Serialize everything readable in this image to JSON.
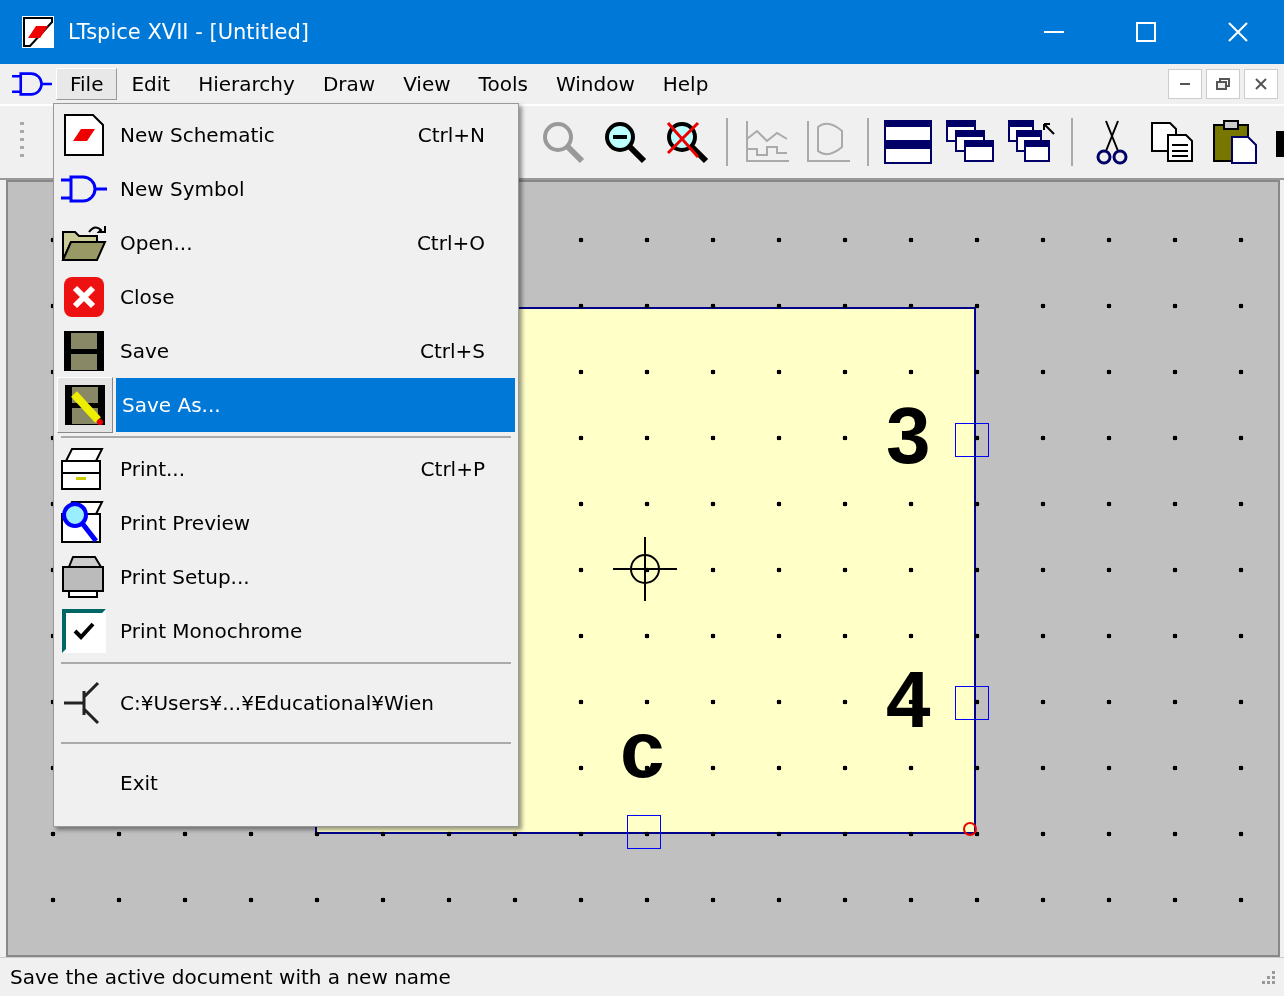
{
  "window": {
    "title": "LTspice XVII - [Untitled]"
  },
  "menu_bar": [
    {
      "label": "File",
      "selected": true
    },
    {
      "label": "Edit",
      "selected": false
    },
    {
      "label": "Hierarchy",
      "selected": false
    },
    {
      "label": "Draw",
      "selected": false
    },
    {
      "label": "View",
      "selected": false
    },
    {
      "label": "Tools",
      "selected": false
    },
    {
      "label": "Window",
      "selected": false
    },
    {
      "label": "Help",
      "selected": false
    }
  ],
  "file_menu": {
    "groups": [
      [
        {
          "kind": "command",
          "label": "New Schematic",
          "shortcut": "Ctrl+N",
          "selected": false
        },
        {
          "kind": "command",
          "label": "New Symbol",
          "selected": false
        },
        {
          "kind": "command",
          "label": "Open...",
          "shortcut": "Ctrl+O",
          "selected": false
        },
        {
          "kind": "command",
          "label": "Close",
          "selected": false
        },
        {
          "kind": "command",
          "label": "Save",
          "shortcut": "Ctrl+S",
          "selected": false
        },
        {
          "kind": "command",
          "label": "Save As...",
          "selected": true
        }
      ],
      [
        {
          "kind": "command",
          "label": "Print...",
          "shortcut": "Ctrl+P",
          "selected": false
        },
        {
          "kind": "command",
          "label": "Print Preview",
          "selected": false
        },
        {
          "kind": "command",
          "label": "Print Setup...",
          "selected": false
        },
        {
          "kind": "check",
          "label": "Print Monochrome",
          "checked": true,
          "selected": false
        }
      ],
      [
        {
          "kind": "command",
          "label": "C:¥Users¥...¥Educational¥Wien",
          "selected": false
        }
      ],
      [
        {
          "kind": "command",
          "label": "Exit",
          "selected": false
        }
      ]
    ]
  },
  "schematic": {
    "labels": [
      "3",
      "4",
      "c"
    ]
  },
  "status_bar": {
    "text": "Save the active document with a new name"
  }
}
